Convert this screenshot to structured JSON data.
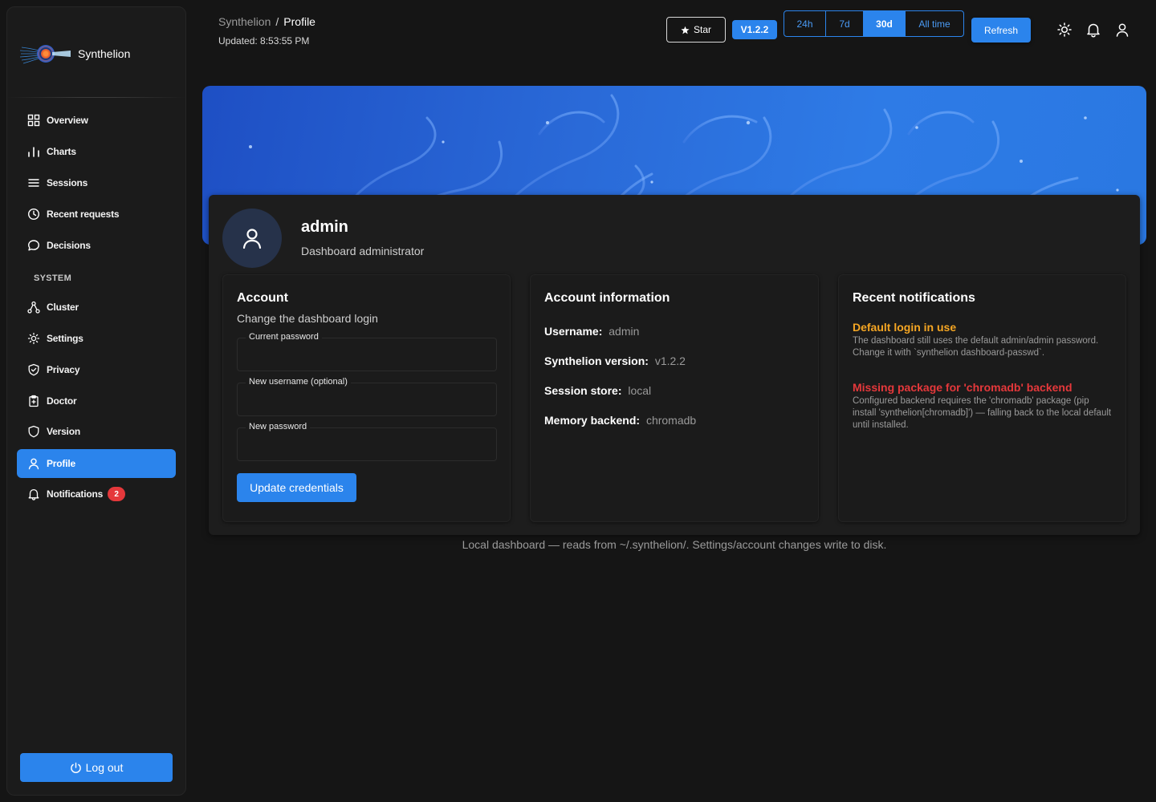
{
  "app": {
    "name": "Synthelion"
  },
  "sidebar": {
    "items": [
      {
        "label": "Overview",
        "icon": "grid-icon"
      },
      {
        "label": "Charts",
        "icon": "bar-chart-icon"
      },
      {
        "label": "Sessions",
        "icon": "list-icon"
      },
      {
        "label": "Recent requests",
        "icon": "clock-icon"
      },
      {
        "label": "Decisions",
        "icon": "chat-icon"
      }
    ],
    "section_label": "SYSTEM",
    "system_items": [
      {
        "label": "Cluster",
        "icon": "cluster-icon"
      },
      {
        "label": "Settings",
        "icon": "gear-icon"
      },
      {
        "label": "Privacy",
        "icon": "shield-check-icon"
      },
      {
        "label": "Doctor",
        "icon": "clipboard-icon"
      },
      {
        "label": "Version",
        "icon": "shield-icon"
      },
      {
        "label": "Profile",
        "icon": "user-icon",
        "active": true
      },
      {
        "label": "Notifications",
        "icon": "bell-icon",
        "badge": "2"
      }
    ],
    "logout_label": "Log out"
  },
  "header": {
    "breadcrumb_root": "Synthelion",
    "breadcrumb_sep": "/",
    "breadcrumb_current": "Profile",
    "updated": "Updated: 8:53:55 PM",
    "star_label": "Star",
    "version_chip": "V1.2.2",
    "ranges": [
      "24h",
      "7d",
      "30d",
      "All time"
    ],
    "active_range": "30d",
    "refresh_label": "Refresh"
  },
  "profile": {
    "username": "admin",
    "role": "Dashboard administrator"
  },
  "account": {
    "title": "Account",
    "subtitle": "Change the dashboard login",
    "current_password_label": "Current password",
    "new_username_label": "New username (optional)",
    "new_password_label": "New password",
    "submit_label": "Update credentials"
  },
  "account_info": {
    "title": "Account information",
    "rows": [
      {
        "key": "Username:",
        "value": "admin"
      },
      {
        "key": "Synthelion version:",
        "value": "v1.2.2"
      },
      {
        "key": "Session store:",
        "value": "local"
      },
      {
        "key": "Memory backend:",
        "value": "chromadb"
      }
    ]
  },
  "notifications": {
    "title": "Recent notifications",
    "items": [
      {
        "title": "Default login in use",
        "color": "#f5a623",
        "body": "The dashboard still uses the default admin/admin password. Change it with `synthelion dashboard-passwd`."
      },
      {
        "title": "Missing package for 'chromadb' backend",
        "color": "#e5383b",
        "body": "Configured backend requires the 'chromadb' package (pip install 'synthelion[chromadb]') — falling back to the local default until installed."
      }
    ]
  },
  "footer": "Local dashboard — reads from ~/.synthelion/. Settings/account changes write to disk.",
  "colors": {
    "accent": "#2b84ec",
    "background": "#151515",
    "warning": "#f5a623",
    "error": "#e5383b"
  }
}
